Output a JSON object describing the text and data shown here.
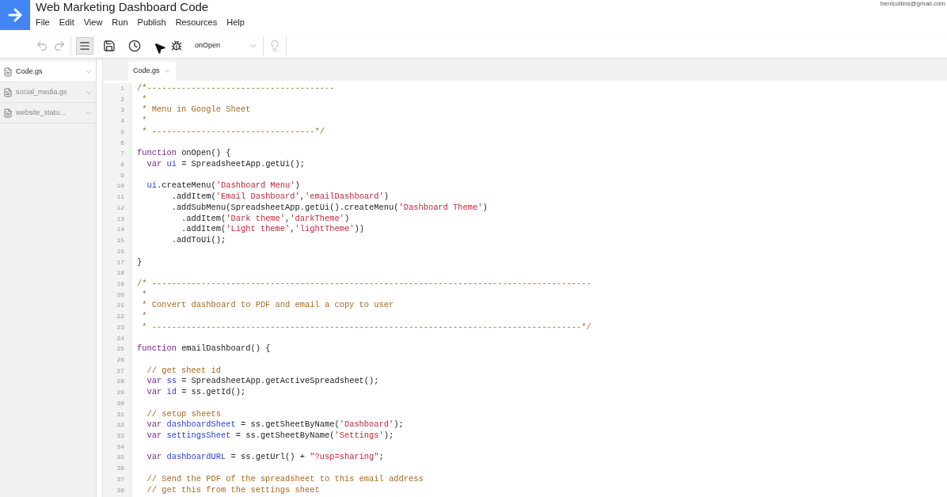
{
  "app": {
    "title": "Web Marketing Dashboard Code",
    "account": "benlcollins@gmail.com"
  },
  "menu": [
    "File",
    "Edit",
    "View",
    "Run",
    "Publish",
    "Resources",
    "Help"
  ],
  "toolbar": {
    "function_select": "onOpen"
  },
  "files": [
    {
      "name": "Code.gs",
      "selected": true
    },
    {
      "name": "social_media.gs",
      "selected": false
    },
    {
      "name": "website_statu...",
      "selected": false
    }
  ],
  "tabs": [
    {
      "label": "Code.gs",
      "selected": true
    }
  ],
  "code": [
    {
      "number": "1",
      "tokens": [
        {
          "kind": "comment",
          "text": "/*--------------------------------------"
        }
      ]
    },
    {
      "number": "2",
      "tokens": [
        {
          "kind": "comment",
          "text": " *"
        }
      ]
    },
    {
      "number": "3",
      "tokens": [
        {
          "kind": "comment",
          "text": " * Menu in Google Sheet"
        }
      ]
    },
    {
      "number": "4",
      "tokens": [
        {
          "kind": "comment",
          "text": " *"
        }
      ]
    },
    {
      "number": "5",
      "tokens": [
        {
          "kind": "comment",
          "text": " * ---------------------------------*/"
        }
      ]
    },
    {
      "number": "6"
    },
    {
      "number": "7",
      "tokens": [
        {
          "kind": "keyword",
          "text": "function"
        },
        {
          "kind": "plain",
          "text": " onOpen() {"
        }
      ]
    },
    {
      "number": "8",
      "tokens": [
        {
          "kind": "keyword",
          "text": "  var"
        },
        {
          "kind": "variable",
          "text": " ui"
        },
        {
          "kind": "plain",
          "text": " = SpreadsheetApp.getUi();"
        }
      ]
    },
    {
      "number": "9"
    },
    {
      "number": "10",
      "tokens": [
        {
          "kind": "variable",
          "text": "  ui"
        },
        {
          "kind": "plain",
          "text": ".createMenu("
        },
        {
          "kind": "string",
          "text": "'Dashboard Menu'"
        },
        {
          "kind": "plain",
          "text": ")"
        }
      ]
    },
    {
      "number": "11",
      "tokens": [
        {
          "kind": "plain",
          "text": "       .addItem("
        },
        {
          "kind": "string",
          "text": "'Email Dashboard'"
        },
        {
          "kind": "plain",
          "text": ","
        },
        {
          "kind": "string",
          "text": "'emailDashboard'"
        },
        {
          "kind": "plain",
          "text": ")"
        }
      ]
    },
    {
      "number": "12",
      "tokens": [
        {
          "kind": "plain",
          "text": "       .addSubMenu(SpreadsheetApp.getUi().createMenu("
        },
        {
          "kind": "string",
          "text": "'Dashboard Theme'"
        },
        {
          "kind": "plain",
          "text": ")"
        }
      ]
    },
    {
      "number": "13",
      "tokens": [
        {
          "kind": "plain",
          "text": "         .addItem("
        },
        {
          "kind": "string",
          "text": "'Dark theme'"
        },
        {
          "kind": "plain",
          "text": ","
        },
        {
          "kind": "string",
          "text": "'darkTheme'"
        },
        {
          "kind": "plain",
          "text": ")"
        }
      ]
    },
    {
      "number": "14",
      "tokens": [
        {
          "kind": "plain",
          "text": "         .addItem("
        },
        {
          "kind": "string",
          "text": "'Light theme'"
        },
        {
          "kind": "plain",
          "text": ","
        },
        {
          "kind": "string",
          "text": "'lightTheme'"
        },
        {
          "kind": "plain",
          "text": "))"
        }
      ]
    },
    {
      "number": "15",
      "tokens": [
        {
          "kind": "plain",
          "text": "       .addToUi();"
        }
      ]
    },
    {
      "number": "16"
    },
    {
      "number": "17",
      "tokens": [
        {
          "kind": "plain",
          "text": "}"
        }
      ]
    },
    {
      "number": "18"
    },
    {
      "number": "19",
      "tokens": [
        {
          "kind": "comment",
          "text": "/* -----------------------------------------------------------------------------------------"
        }
      ]
    },
    {
      "number": "20",
      "tokens": [
        {
          "kind": "comment",
          "text": " *"
        }
      ]
    },
    {
      "number": "21",
      "tokens": [
        {
          "kind": "comment",
          "text": " * Convert dashboard to PDF and email a copy to user"
        }
      ]
    },
    {
      "number": "22",
      "tokens": [
        {
          "kind": "comment",
          "text": " *"
        }
      ]
    },
    {
      "number": "23",
      "tokens": [
        {
          "kind": "comment",
          "text": " * ---------------------------------------------------------------------------------------*/"
        }
      ]
    },
    {
      "number": "24"
    },
    {
      "number": "25",
      "tokens": [
        {
          "kind": "keyword",
          "text": "function"
        },
        {
          "kind": "plain",
          "text": " emailDashboard() {"
        }
      ]
    },
    {
      "number": "26"
    },
    {
      "number": "27",
      "tokens": [
        {
          "kind": "comment",
          "text": "  // get sheet id"
        }
      ]
    },
    {
      "number": "28",
      "tokens": [
        {
          "kind": "keyword",
          "text": "  var"
        },
        {
          "kind": "variable",
          "text": " ss"
        },
        {
          "kind": "plain",
          "text": " = SpreadsheetApp.getActiveSpreadsheet();"
        }
      ]
    },
    {
      "number": "29",
      "tokens": [
        {
          "kind": "keyword",
          "text": "  var"
        },
        {
          "kind": "variable",
          "text": " id"
        },
        {
          "kind": "plain",
          "text": " = ss.getId();"
        }
      ]
    },
    {
      "number": "30"
    },
    {
      "number": "31",
      "tokens": [
        {
          "kind": "comment",
          "text": "  // setup sheets"
        }
      ]
    },
    {
      "number": "32",
      "tokens": [
        {
          "kind": "keyword",
          "text": "  var"
        },
        {
          "kind": "variable",
          "text": " dashboardSheet"
        },
        {
          "kind": "plain",
          "text": " = ss.getSheetByName("
        },
        {
          "kind": "string",
          "text": "'Dashboard'"
        },
        {
          "kind": "plain",
          "text": ");"
        }
      ]
    },
    {
      "number": "33",
      "tokens": [
        {
          "kind": "keyword",
          "text": "  var"
        },
        {
          "kind": "variable",
          "text": " settingsSheet"
        },
        {
          "kind": "plain",
          "text": " = ss.getSheetByName("
        },
        {
          "kind": "string",
          "text": "'Settings'"
        },
        {
          "kind": "plain",
          "text": ");"
        }
      ]
    },
    {
      "number": "34"
    },
    {
      "number": "35",
      "tokens": [
        {
          "kind": "keyword",
          "text": "  var"
        },
        {
          "kind": "variable",
          "text": " dashboardURL"
        },
        {
          "kind": "plain",
          "text": " = ss.getUrl() + "
        },
        {
          "kind": "string",
          "text": "\"?usp=sharing\""
        },
        {
          "kind": "plain",
          "text": ";"
        }
      ]
    },
    {
      "number": "36"
    },
    {
      "number": "37",
      "tokens": [
        {
          "kind": "comment",
          "text": "  // Send the PDF of the spreadsheet to this email address"
        }
      ]
    },
    {
      "number": "38",
      "tokens": [
        {
          "kind": "comment",
          "text": "  // get this from the settings sheet"
        }
      ]
    }
  ]
}
